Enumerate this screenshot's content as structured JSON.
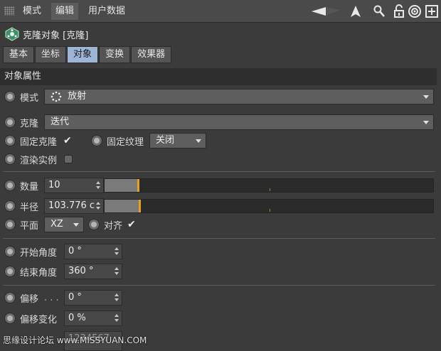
{
  "menu": {
    "mode": "模式",
    "edit": "编辑",
    "user_data": "用户数据"
  },
  "object": {
    "title": "克隆对象 [克隆]"
  },
  "tabs": [
    "基本",
    "坐标",
    "对象",
    "变换",
    "效果器"
  ],
  "section": {
    "title": "对象属性"
  },
  "fields": {
    "mode": {
      "label": "模式",
      "value": "放射"
    },
    "clone": {
      "label": "克隆",
      "value": "迭代"
    },
    "fix_clone": {
      "label": "固定克隆",
      "checked": true
    },
    "fix_texture": {
      "label": "固定纹理",
      "value": "关闭"
    },
    "render_instances": {
      "label": "渲染实例",
      "checked": false
    },
    "count": {
      "label": "数量",
      "value": "10",
      "level": 0.1
    },
    "radius": {
      "label": "半径",
      "value": "103.776 c",
      "level": 0.104
    },
    "plane": {
      "label": "平面",
      "value": "XZ"
    },
    "align": {
      "label": "对齐",
      "checked": true
    },
    "start_angle": {
      "label": "开始角度",
      "value": "0 °"
    },
    "end_angle": {
      "label": "结束角度",
      "value": "360 °"
    },
    "offset": {
      "label": "偏移",
      "value": "0 °",
      "dots": ". . ."
    },
    "offset_variation": {
      "label": "偏移变化",
      "value": "0 %"
    },
    "seed": {
      "value": "1234567"
    }
  },
  "watermark": "思缘设计论坛 www.MISSYUAN.COM",
  "colors": {
    "accent": "#e8a020",
    "active_tab": "#9db6d8",
    "panel": "#3b3b3b"
  }
}
